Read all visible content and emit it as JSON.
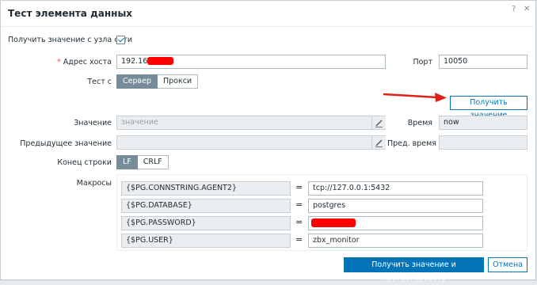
{
  "dialog": {
    "title": "Тест элемента данных",
    "help_icon": "?",
    "close_icon": "✕"
  },
  "form": {
    "get_from_host_label": "Получить значение с узла сети",
    "get_from_host_checked": true,
    "host_address_label": "Адрес хоста",
    "host_address_value": "192.168.",
    "port_label": "Порт",
    "port_value": "10050",
    "test_with_label": "Тест с",
    "test_with_options": [
      "Сервер",
      "Прокси"
    ],
    "test_with_selected": "Сервер",
    "get_value_button": "Получить значение",
    "value_label": "Значение",
    "value_placeholder": "значение",
    "time_label": "Время",
    "time_value": "now",
    "prev_value_label": "Предыдущее значение",
    "prev_value_value": "",
    "prev_time_label": "Пред. время",
    "prev_time_value": "",
    "eol_label": "Конец строки",
    "eol_options": [
      "LF",
      "CRLF"
    ],
    "eol_selected": "LF",
    "macros_label": "Макросы",
    "macros": [
      {
        "name": "{$PG.CONNSTRING.AGENT2}",
        "value": "tcp://127.0.0.1:5432"
      },
      {
        "name": "{$PG.DATABASE}",
        "value": "postgres"
      },
      {
        "name": "{$PG.PASSWORD}",
        "value": ""
      },
      {
        "name": "{$PG.USER}",
        "value": "zbx_monitor"
      }
    ]
  },
  "footer": {
    "submit_button": "Получить значение и протестировать",
    "cancel_button": "Отмена"
  },
  "colors": {
    "accent": "#0275b8",
    "segment_active": "#768d99",
    "annotation_arrow": "#e0201b",
    "redaction": "#ff0000"
  }
}
